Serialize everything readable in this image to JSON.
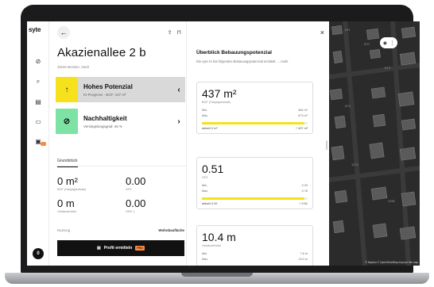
{
  "app": {
    "logo": "syte"
  },
  "sidebar": {
    "icons": [
      "compass-icon",
      "search-icon",
      "calculator-icon",
      "folder-icon",
      "chat-icon"
    ],
    "avatar_initial": "0",
    "badge_color": "#ff8a3d"
  },
  "property": {
    "address": "Akazienallee 2 b",
    "address_sub": "48155 Münster, Stadt",
    "potential": {
      "title": "Hohes Potenzial",
      "subtitle": "KI-Prognose · BGF: 437 m²",
      "icon": "arrow-up-icon",
      "color": "#f5e21c",
      "chevron": "‹"
    },
    "sustainability": {
      "title": "Nachhaltigkeit",
      "subtitle": "Versiegelungsgrad: 46 %",
      "icon": "leaf-icon",
      "color": "#7de3a4",
      "chevron": "›"
    },
    "section_tab": "Grundstück",
    "metrics": [
      {
        "value": "0 m²",
        "label": "BGF (Hauptgebäude)"
      },
      {
        "value": "0.00",
        "label": "GFZ"
      },
      {
        "value": "0 m",
        "label": "Gebäudehöhe"
      },
      {
        "value": "0.00",
        "label": "GRZ 1"
      }
    ],
    "usage_label": "Nutzung",
    "usage_value": "Wohnbaufläche",
    "profit_button": "Profit ermitteln",
    "profit_badge": "PRO"
  },
  "detail": {
    "title": "Überblick Bebauungspotenzial",
    "subtitle": "Die syte KI hat folgendes Bebauungspotenzial ermittelt. ... mehr",
    "close_label": "×",
    "cards": [
      {
        "value": "437 m²",
        "label": "BGF (Hauptgebäude)",
        "min_label": "Min.",
        "min_value": "284 m²",
        "max_label": "Max.",
        "max_value": "673 m²",
        "progress": 0.97,
        "current_label": "aktuell 0 m²",
        "delta": "+ 437 m²"
      },
      {
        "value": "0.51",
        "label": "GFZ",
        "min_label": "Min.",
        "min_value": "0.33",
        "max_label": "Max.",
        "max_value": "0.78",
        "progress": 0.97,
        "current_label": "aktuell 0.00",
        "delta": "+ 0.51"
      },
      {
        "value": "10.4 m",
        "label": "Gebäudehöhe",
        "min_label": "Min.",
        "min_value": "7.8 m",
        "max_label": "Max.",
        "max_value": "13.0 m"
      }
    ]
  },
  "map": {
    "attribution": "© Mapbox © OpenStreetMap Improve this map",
    "pin_icons": [
      "eye-icon",
      "more-icon"
    ],
    "house_numbers": [
      "671",
      "670",
      "673",
      "674",
      "1250",
      "1271"
    ]
  }
}
